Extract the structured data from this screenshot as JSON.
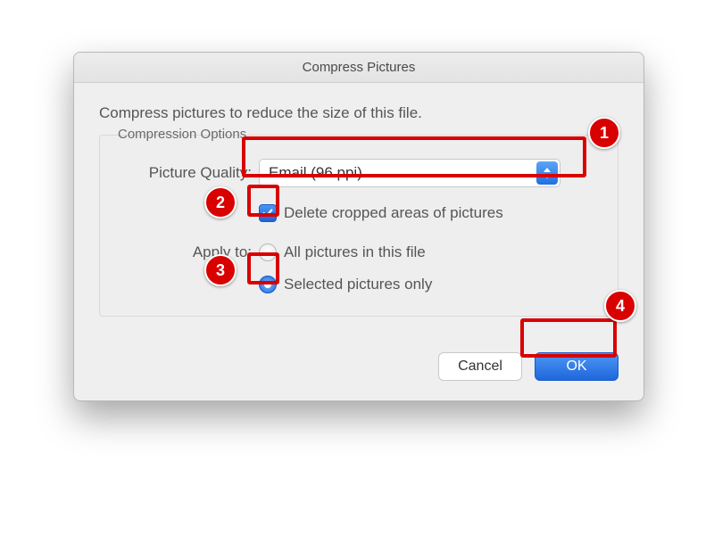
{
  "dialog": {
    "title": "Compress Pictures",
    "intro": "Compress pictures to reduce the size of this file.",
    "group_title": "Compression Options",
    "picture_quality_label": "Picture Quality:",
    "picture_quality_value": "Email (96 ppi)",
    "delete_crop_label": "Delete cropped areas of pictures",
    "delete_crop_checked": true,
    "apply_to_label": "Apply to:",
    "apply_opts": {
      "all": "All pictures in this file",
      "selected": "Selected pictures only"
    },
    "apply_selected": "selected",
    "buttons": {
      "cancel": "Cancel",
      "ok": "OK"
    }
  },
  "annotations": {
    "b1": "1",
    "b2": "2",
    "b3": "3",
    "b4": "4"
  }
}
